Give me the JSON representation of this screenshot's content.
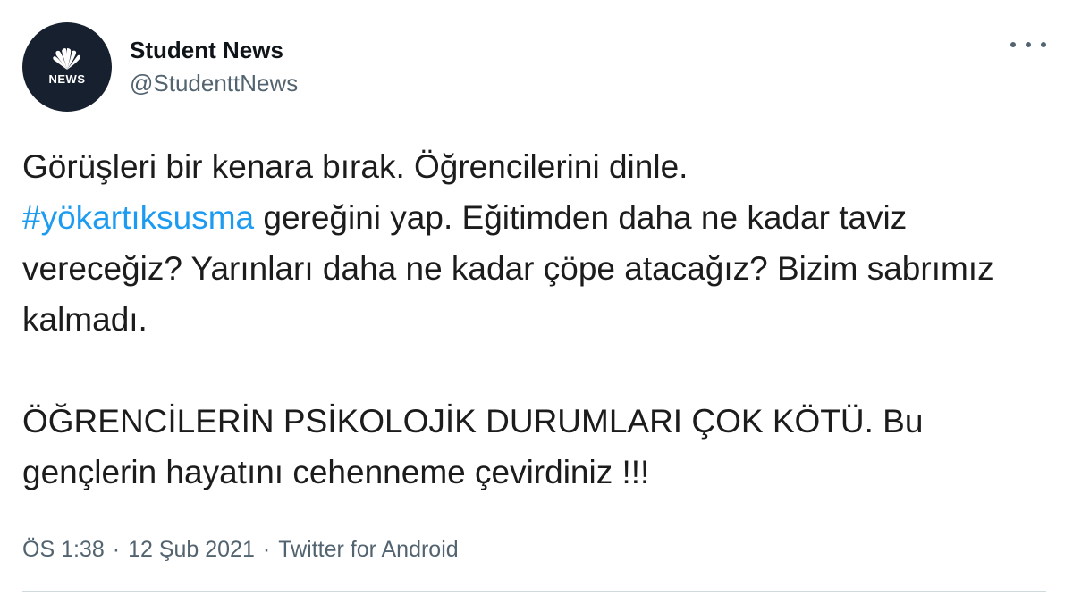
{
  "user": {
    "display_name": "Student News",
    "handle": "@StudenttNews",
    "avatar_text": "NEWS",
    "avatar_icon": "peacock-logo-icon"
  },
  "tweet": {
    "line1_prefix": "Görüşleri bir kenara bırak. Öğrencilerini dinle.",
    "hashtag": "#yökartıksusma",
    "line2_suffix": " gereğini yap. Eğitimden daha ne kadar taviz vereceğiz? Yarınları daha ne kadar çöpe atacağız? Bizim sabrımız kalmadı.",
    "paragraph2": "ÖĞRENCİLERİN PSİKOLOJİK DURUMLARI ÇOK KÖTÜ. Bu gençlerin hayatını cehenneme çevirdiniz !!!"
  },
  "meta": {
    "time": "ÖS 1:38",
    "date": "12 Şub 2021",
    "source": "Twitter for Android",
    "separator": "·"
  },
  "colors": {
    "hashtag": "#1d9bf0",
    "secondary_text": "#536471",
    "avatar_bg": "#16202e"
  },
  "icons": {
    "more": "more-options-icon"
  }
}
